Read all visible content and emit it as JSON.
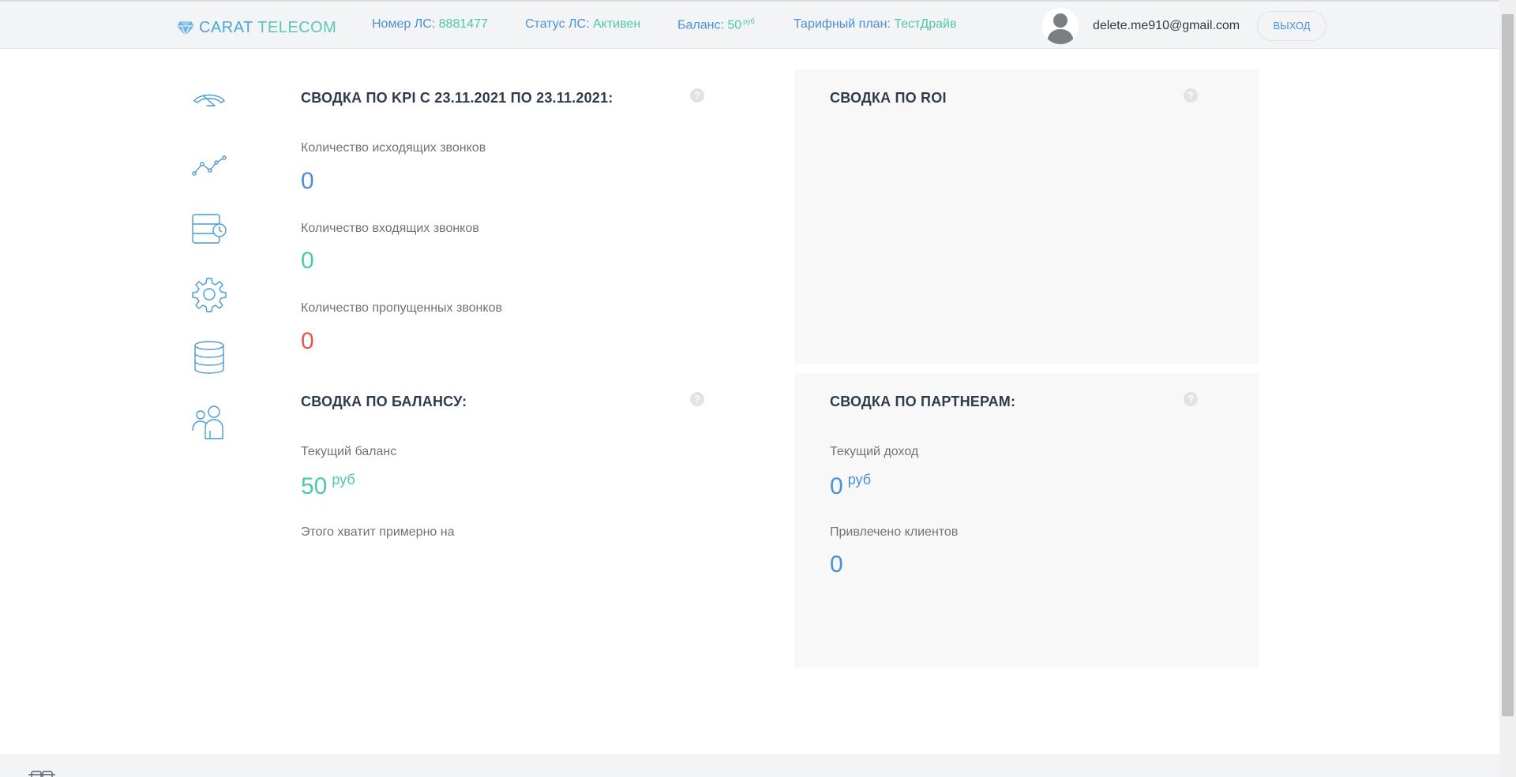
{
  "app": {
    "brand_part1": "CARAT",
    "brand_part2": "TELECOM"
  },
  "header": {
    "account_label": "Номер ЛС:",
    "account_value": "8881477",
    "status_label": "Статус ЛС:",
    "status_value": "Активен",
    "balance_label": "Баланс:",
    "balance_value": "50",
    "balance_unit": "руб",
    "plan_label": "Тарифный план:",
    "plan_value": "ТестДрайв",
    "email": "delete.me910@gmail.com",
    "logout_label": "выход"
  },
  "sidebar": {
    "items": [
      {
        "icon": "speedometer-icon"
      },
      {
        "icon": "line-chart-icon"
      },
      {
        "icon": "call-history-icon"
      },
      {
        "icon": "gear-icon"
      },
      {
        "icon": "database-icon"
      },
      {
        "icon": "users-icon"
      }
    ]
  },
  "kpi": {
    "title": "СВОДКА ПО KPI С 23.11.2021 ПО 23.11.2021:",
    "outgoing_label": "Количество исходящих звонков",
    "outgoing_value": "0",
    "incoming_label": "Количество входящих звонков",
    "incoming_value": "0",
    "missed_label": "Количество пропущенных звонков",
    "missed_value": "0"
  },
  "roi": {
    "title": "СВОДКА ПО ROI"
  },
  "balance": {
    "title": "СВОДКА ПО БАЛАНСУ:",
    "current_label": "Текущий баланс",
    "current_value": "50",
    "current_unit": "руб",
    "enough_label": "Этого хватит примерно на"
  },
  "partners": {
    "title": "СВОДКА ПО ПАРТНЕРАМ:",
    "income_label": "Текущий доход",
    "income_value": "0",
    "income_unit": "руб",
    "clients_label": "Привлечено клиентов",
    "clients_value": "0"
  },
  "help_glyph": "?",
  "colors": {
    "accent_blue": "#4a90d9",
    "accent_green": "#4cc9a8",
    "accent_red": "#e15a4f"
  }
}
